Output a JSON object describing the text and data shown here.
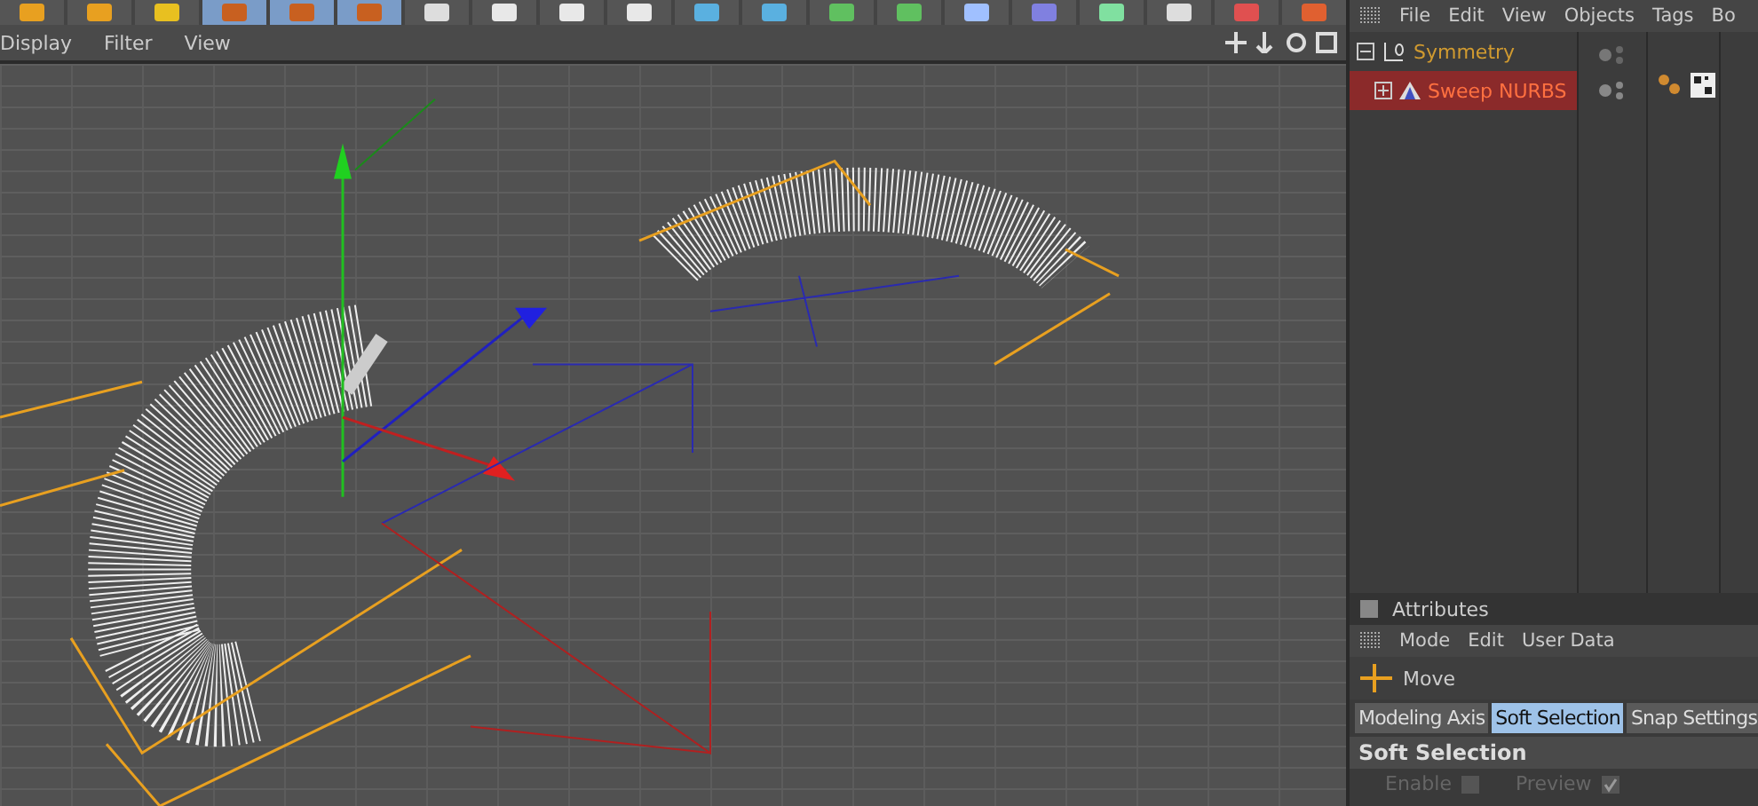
{
  "toolbar": {
    "tools": [
      {
        "kind": "frame",
        "selected": false
      },
      {
        "kind": "undo",
        "selected": false
      },
      {
        "kind": "axis",
        "selected": false
      },
      {
        "kind": "lockx",
        "selected": true
      },
      {
        "kind": "locky",
        "selected": true
      },
      {
        "kind": "lockz",
        "selected": true
      },
      {
        "kind": "coord",
        "selected": false
      },
      {
        "kind": "render",
        "selected": false
      },
      {
        "kind": "render",
        "selected": false
      },
      {
        "kind": "render",
        "selected": false
      },
      {
        "kind": "cube",
        "selected": false
      },
      {
        "kind": "pen",
        "selected": false
      },
      {
        "kind": "subdiv",
        "selected": false
      },
      {
        "kind": "array",
        "selected": false
      },
      {
        "kind": "deform",
        "selected": false
      },
      {
        "kind": "scene",
        "selected": false
      },
      {
        "kind": "light",
        "selected": false
      },
      {
        "kind": "cursor",
        "selected": false
      },
      {
        "kind": "grid",
        "selected": false
      },
      {
        "kind": "sphere",
        "selected": false
      }
    ]
  },
  "viewport": {
    "menu": [
      "Display",
      "Filter",
      "View"
    ]
  },
  "objects": {
    "menu": [
      "File",
      "Edit",
      "View",
      "Objects",
      "Tags",
      "Bo"
    ],
    "tree": [
      {
        "name": "Symmetry",
        "selected": false,
        "expanded": true,
        "children": [
          {
            "name": "Sweep NURBS",
            "selected": true,
            "expanded": false
          }
        ]
      }
    ]
  },
  "attributes": {
    "title": "Attributes",
    "menu": [
      "Mode",
      "Edit",
      "User Data"
    ],
    "object": "Move",
    "tabs": [
      {
        "label": "Modeling Axis",
        "selected": false
      },
      {
        "label": "Soft Selection",
        "selected": true
      },
      {
        "label": "Snap Settings",
        "selected": false
      }
    ],
    "section": "Soft Selection",
    "fields": [
      {
        "label": "Enable",
        "checked": false
      },
      {
        "label": "Preview",
        "checked": true
      }
    ]
  }
}
